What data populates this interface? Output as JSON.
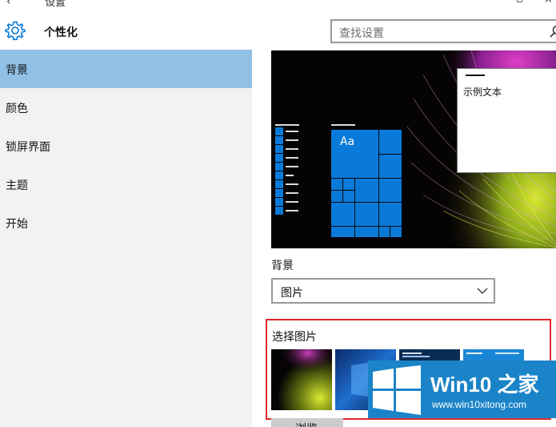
{
  "window": {
    "title": "设置",
    "back_icon": "back-arrow-icon",
    "minimize_icon": "minimize-icon",
    "close_icon": "close-icon"
  },
  "header": {
    "icon": "gear-icon",
    "title": "个性化",
    "search": {
      "placeholder": "查找设置",
      "icon": "search-icon"
    }
  },
  "sidebar": {
    "items": [
      {
        "label": "背景",
        "selected": true
      },
      {
        "label": "颜色",
        "selected": false
      },
      {
        "label": "锁屏界面",
        "selected": false
      },
      {
        "label": "主题",
        "selected": false
      },
      {
        "label": "开始",
        "selected": false
      }
    ]
  },
  "main": {
    "preview": {
      "sample_text": "示例文本",
      "tile_label": "Aa"
    },
    "background_label": "背景",
    "background_dropdown": {
      "value": "图片",
      "icon": "chevron-down-icon"
    },
    "choose_picture_label": "选择图片",
    "browse_button_label": "浏览"
  },
  "watermark": {
    "title": "Win10 之家",
    "url": "www.win10xitong.com",
    "logo_icon": "windows-logo-icon"
  },
  "colors": {
    "accent": "#0078d7",
    "selected_nav": "#90c0e6",
    "sidebar_bg": "#f2f2f2",
    "highlight_border": "#e0282c",
    "watermark_bg": "#1b84c8"
  }
}
